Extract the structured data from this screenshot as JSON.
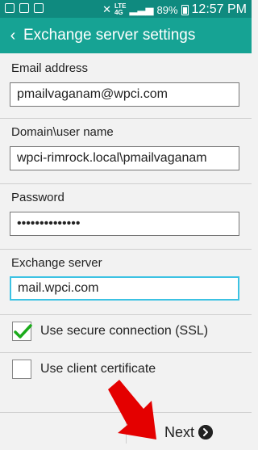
{
  "status_bar": {
    "network_top": "LTE",
    "network_bottom": "4G",
    "battery": "89%",
    "time": "12:57 PM"
  },
  "app_bar": {
    "title": "Exchange server settings"
  },
  "fields": [
    {
      "label": "Email address",
      "value": "pmailvaganam@wpci.com"
    },
    {
      "label": "Domain\\user name",
      "value": "wpci-rimrock.local\\pmailvaganam"
    },
    {
      "label": "Password",
      "value": "••••••••••••••"
    },
    {
      "label": "Exchange server",
      "value": "mail.wpci.com"
    }
  ],
  "options": [
    {
      "label": "Use secure connection (SSL)",
      "checked": true
    },
    {
      "label": "Use client certificate",
      "checked": false
    }
  ],
  "bottom": {
    "next_label": "Next"
  },
  "colors": {
    "status_bar": "#0f8a7f",
    "app_bar": "#16a394",
    "focus_border": "#3cc2e3",
    "check": "#1bab1b",
    "annotation_arrow": "#e40000"
  }
}
